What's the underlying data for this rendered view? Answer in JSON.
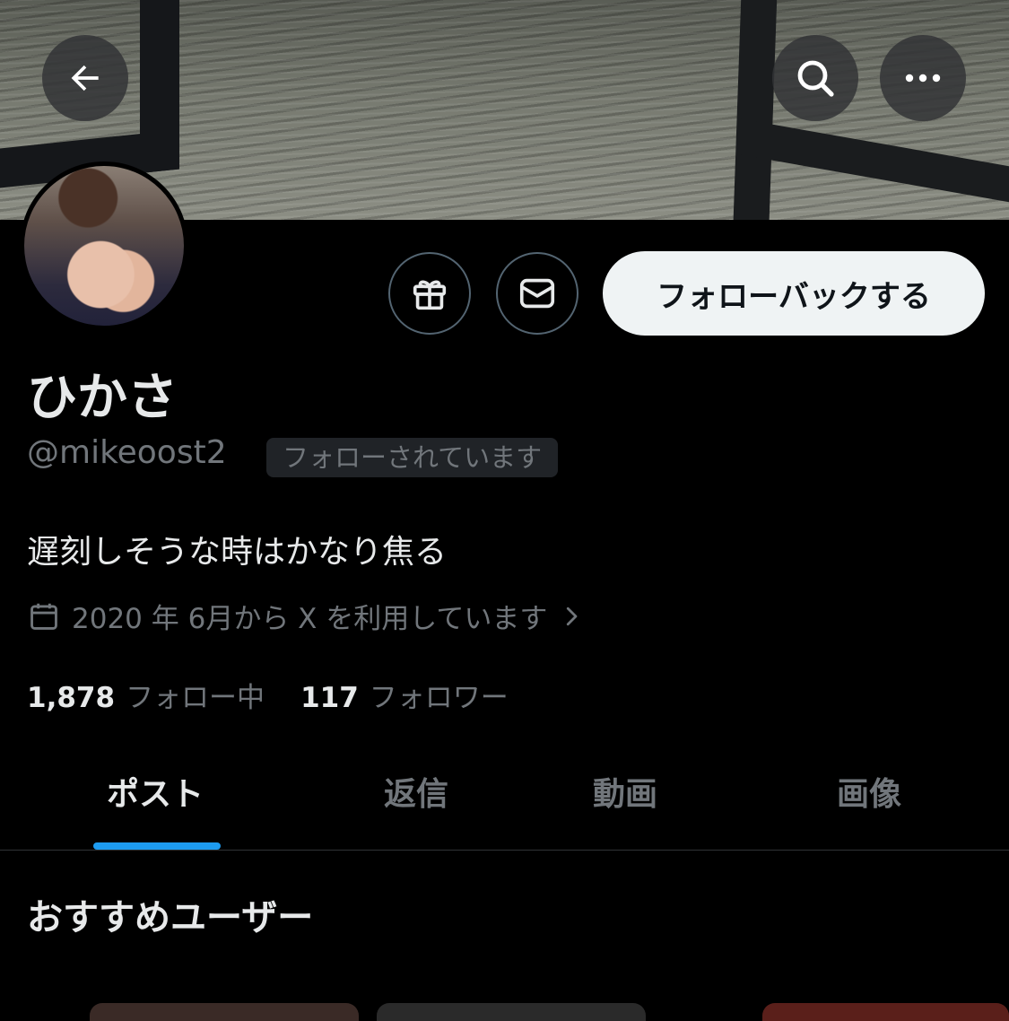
{
  "profile": {
    "name": "ひかさ",
    "handle": "@mikeoost2",
    "follows_you": "フォローされています",
    "bio": "遅刻しそうな時はかなり焦る",
    "joined": "2020 年 6月から X を利用しています",
    "following_count": "1,878",
    "following_label": "フォロー中",
    "followers_count": "117",
    "followers_label": "フォロワー"
  },
  "actions": {
    "follow_back_label": "フォローバックする"
  },
  "tabs": [
    {
      "label": "ポスト",
      "active": true
    },
    {
      "label": "返信",
      "active": false
    },
    {
      "label": "動画",
      "active": false
    },
    {
      "label": "画像",
      "active": false
    }
  ],
  "recommended": {
    "title": "おすすめユーザー"
  },
  "icons": {
    "back": "arrow-left-icon",
    "search": "search-icon",
    "more": "more-horizontal-icon",
    "gift": "gift-icon",
    "message": "envelope-icon",
    "calendar": "calendar-icon",
    "chevron": "chevron-right-icon"
  },
  "colors": {
    "background": "#000000",
    "accent": "#1d9bf0",
    "text_primary": "#e7e9ea",
    "text_secondary": "#71767b"
  }
}
